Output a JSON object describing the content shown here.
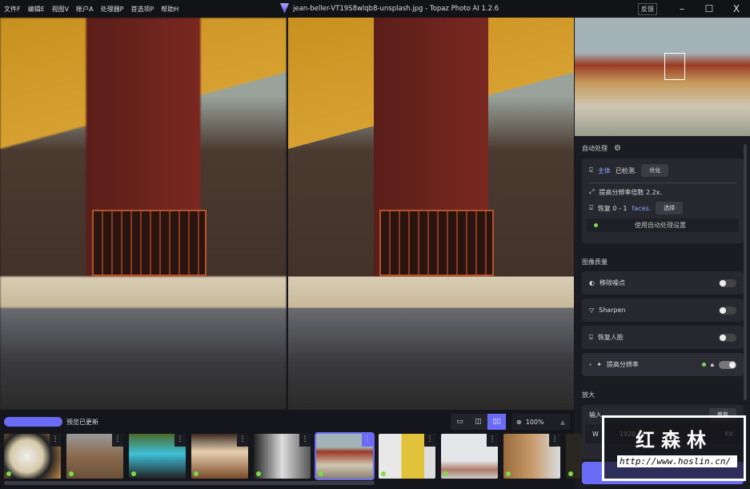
{
  "menu": [
    "文件F",
    "编辑E",
    "视图V",
    "帐户A",
    "处理器P",
    "首选项P",
    "帮助H"
  ],
  "window": {
    "title": "jean-beller-VT19S8wlqb8-unsplash.jpg - Topaz Photo AI 1.2.6",
    "feedback": "反馈",
    "minimize": "–",
    "maximize": "☐",
    "close": "X"
  },
  "panel": {
    "auto_title": "自动处理",
    "subject_label": "主体",
    "subject_detected": "已检测.",
    "optimize": "优化",
    "upscale_text": "提高分辨率倍数 2.2x.",
    "restore_prefix": "恢复 0 - 1",
    "restore_faces": "faces.",
    "choose": "选择",
    "use_auto": "使用自动处理设置",
    "quality_title": "图像质量",
    "filters": [
      {
        "label": "移除噪点",
        "on": false
      },
      {
        "label": "Sharpen",
        "on": false
      },
      {
        "label": "恢复人脸",
        "on": false
      },
      {
        "label": "提高分辨率",
        "on": true
      }
    ],
    "enlarge_title": "放大",
    "input_label": "输入",
    "crop": "裁剪",
    "w_label": "W",
    "width_value": "1920",
    "unit": "PX"
  },
  "bottom": {
    "status": "预览已更新",
    "zoom": "100%",
    "thumbnail_count": 10,
    "selected_index": 5
  },
  "watermark": {
    "text": "红森林",
    "url": "http://www.hoslin.cn/"
  },
  "colors": {
    "accent": "#6a6cf6",
    "status_green": "#7bdc4a"
  }
}
